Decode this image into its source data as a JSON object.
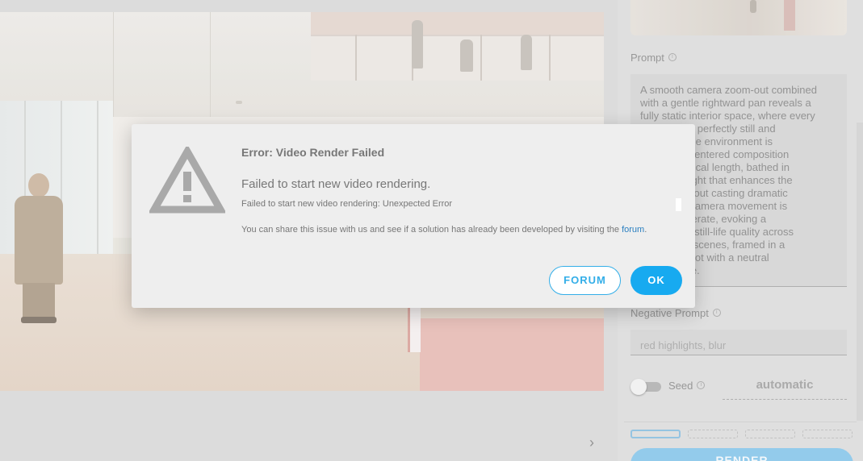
{
  "settings": {
    "prompt_label": "Prompt",
    "prompt_text": "A smooth camera zoom-out combined\nwith a gentle rightward pan reveals a\nfully static interior space, where every\n            ains perfectly still and\n            d; the environment is\n            ith centered composition\n            m focal length, bathed in\n            nt light that enhances the\n            without casting dramatic\n            he camera movement is\n            eliberate, evoking a\n            ive, still-life quality across\n            rior scenes, framed in a\n            e shot with a neutral\n            style.",
    "negative_prompt_label": "Negative Prompt",
    "negative_prompt_placeholder": "red highlights, blur",
    "seed_label": "Seed",
    "seed_value": "automatic",
    "render_label": "RENDER"
  },
  "icons": {
    "info": "info-icon",
    "warning": "warning-triangle-icon",
    "next": "chevron-right-icon"
  },
  "dialog": {
    "title": "Error: Video Render Failed",
    "heading": "Failed to start new video rendering.",
    "detail": "Failed to start new video rendering: Unexpected Error",
    "help_prefix": "You can share this issue with us and see if a solution has already been developed by visiting the ",
    "help_link": "forum",
    "help_suffix": ".",
    "forum_button": "FORUM",
    "ok_button": "OK"
  },
  "colors": {
    "accent": "#17aaf0",
    "link": "#2a7fc0",
    "warning_icon": "#a9a9a9"
  }
}
